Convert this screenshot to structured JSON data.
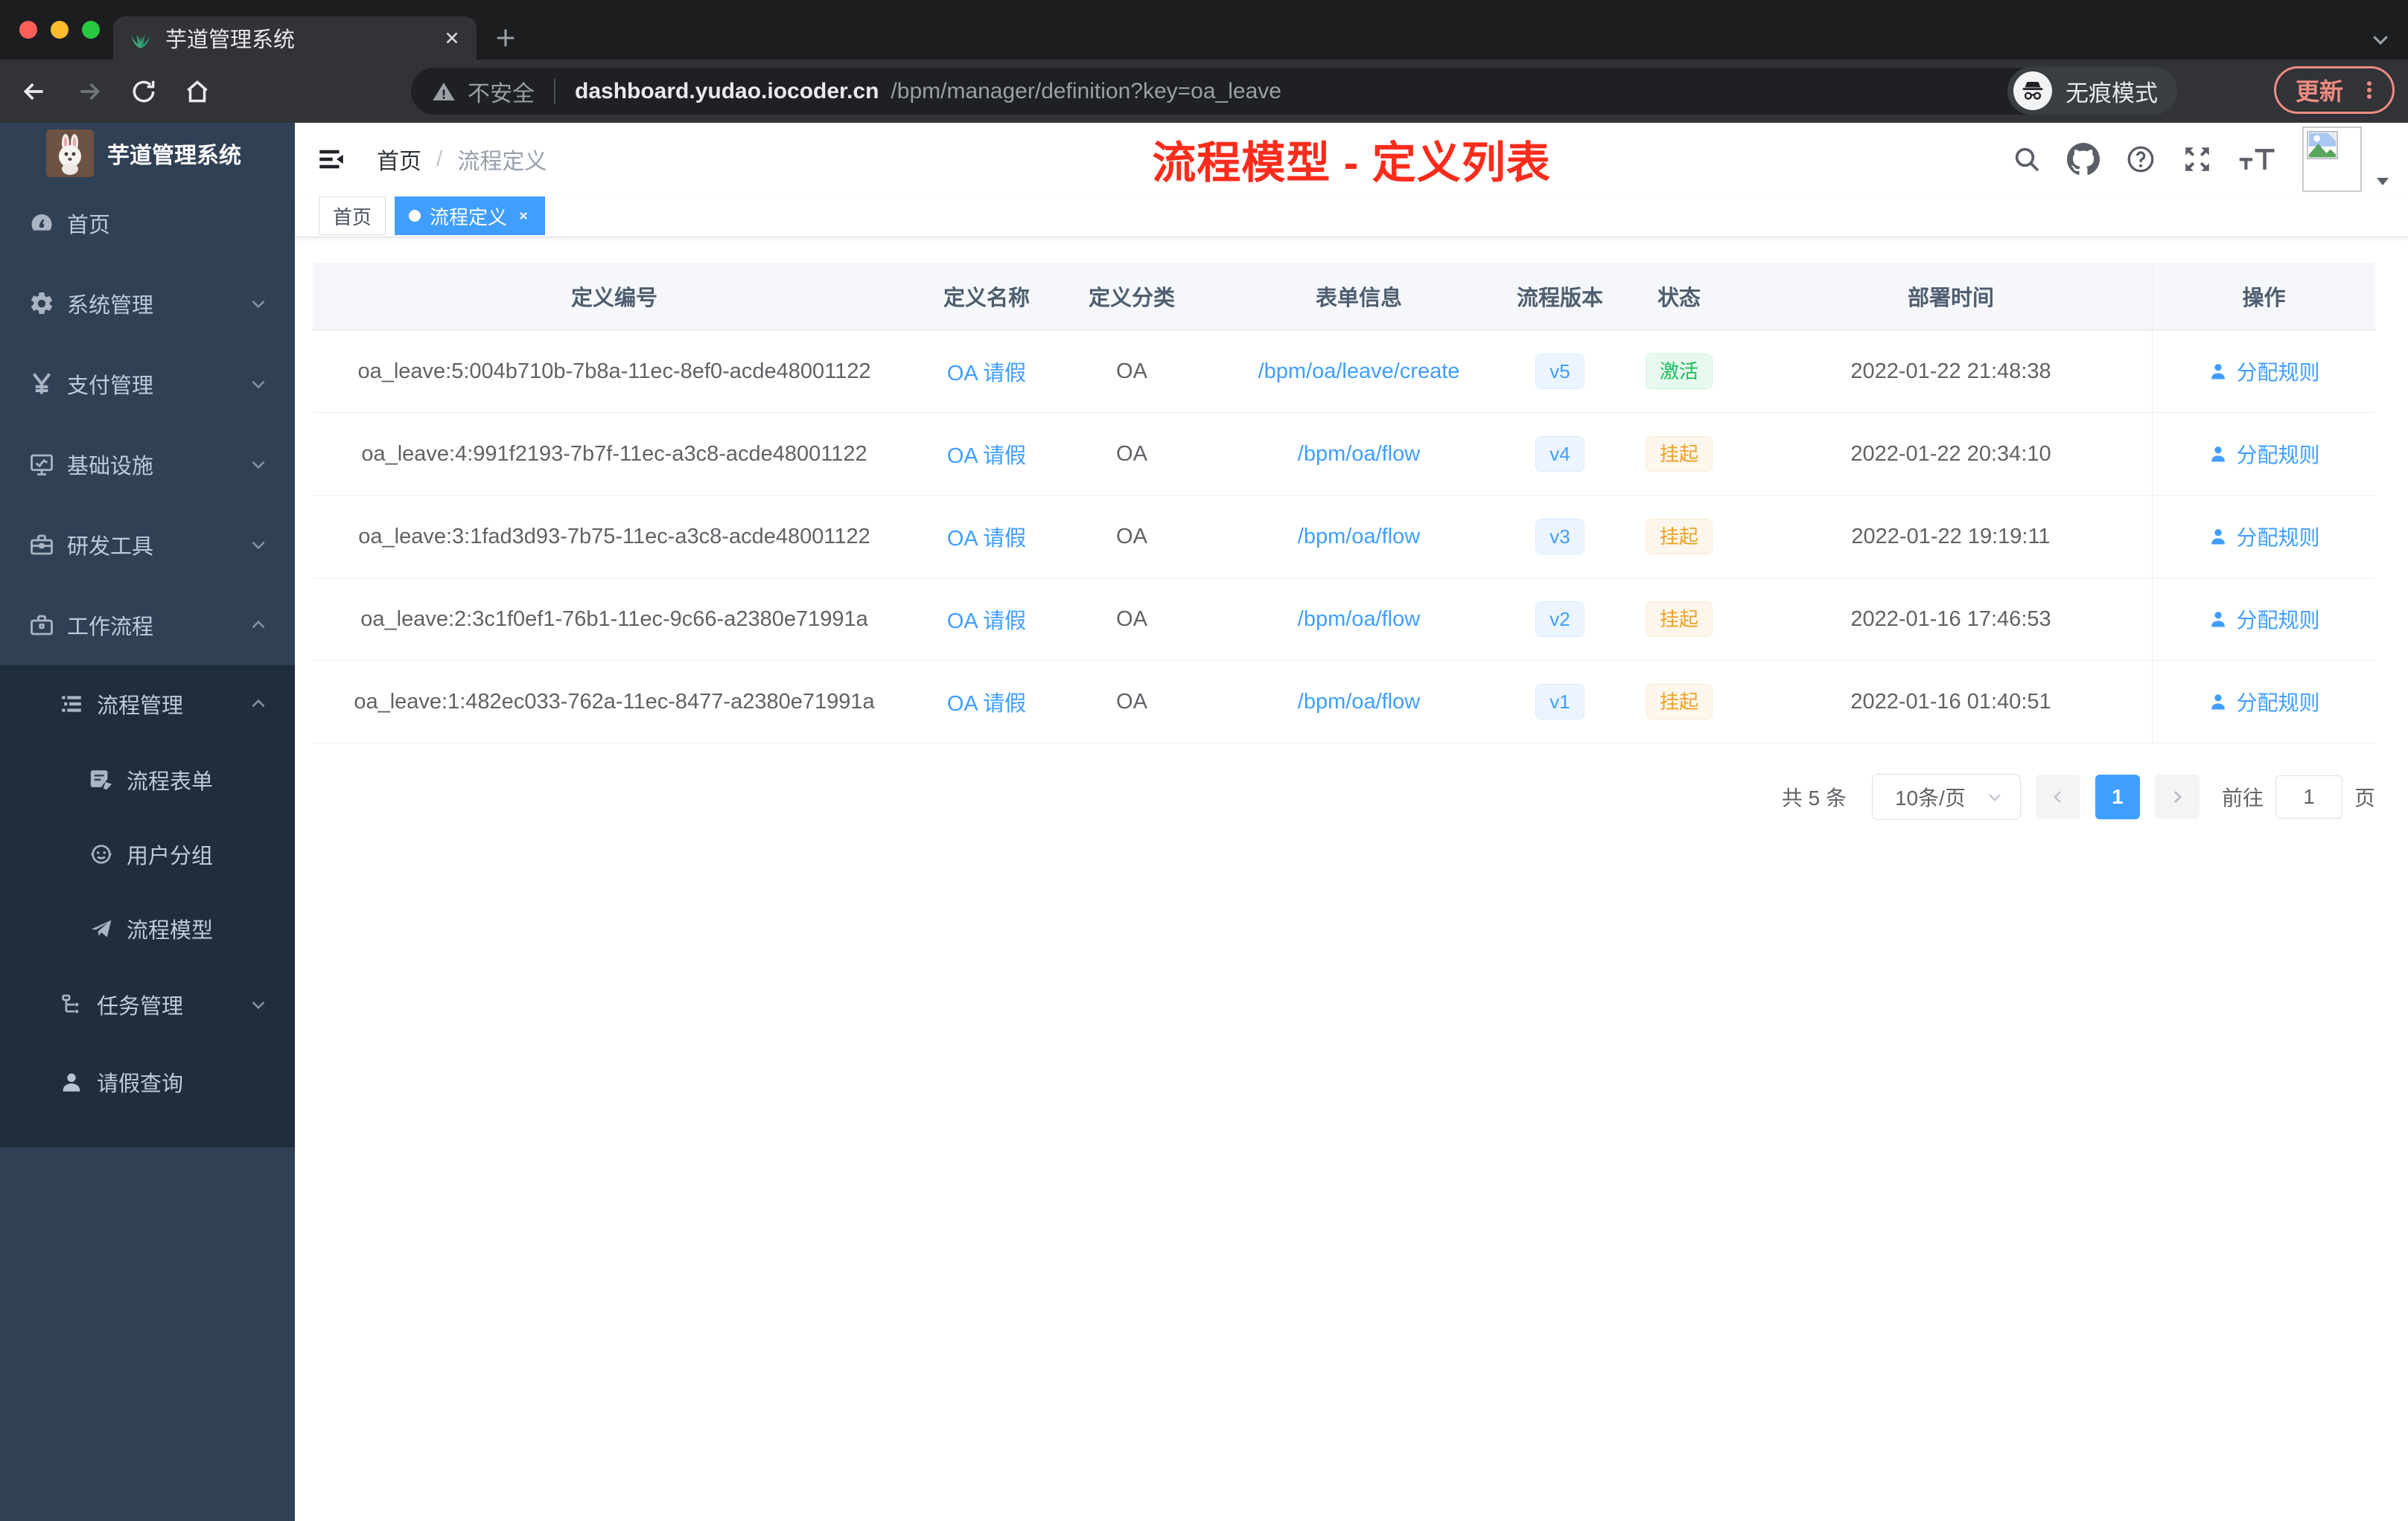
{
  "browser": {
    "tab_title": "芋道管理系统",
    "security_label": "不安全",
    "url_host": "dashboard.yudao.iocoder.cn",
    "url_path": "/bpm/manager/definition?key=oa_leave",
    "incognito_label": "无痕模式",
    "update_label": "更新"
  },
  "sidebar": {
    "app_title": "芋道管理系统",
    "items": [
      {
        "label": "首页"
      },
      {
        "label": "系统管理"
      },
      {
        "label": "支付管理"
      },
      {
        "label": "基础设施"
      },
      {
        "label": "研发工具"
      },
      {
        "label": "工作流程"
      },
      {
        "label": "流程管理"
      },
      {
        "label": "流程表单"
      },
      {
        "label": "用户分组"
      },
      {
        "label": "流程模型"
      },
      {
        "label": "任务管理"
      },
      {
        "label": "请假查询"
      }
    ]
  },
  "navbar": {
    "breadcrumb_home": "首页",
    "breadcrumb_sep": "/",
    "breadcrumb_current": "流程定义",
    "annotation": "流程模型 - 定义列表"
  },
  "tags": {
    "home": "首页",
    "active": "流程定义"
  },
  "table": {
    "columns": [
      "定义编号",
      "定义名称",
      "定义分类",
      "表单信息",
      "流程版本",
      "状态",
      "部署时间",
      "操作"
    ],
    "rows": [
      {
        "id": "oa_leave:5:004b710b-7b8a-11ec-8ef0-acde48001122",
        "name": "OA 请假",
        "category": "OA",
        "form": "/bpm/oa/leave/create",
        "version": "v5",
        "status": "激活",
        "status_type": "active",
        "time": "2022-01-22 21:48:38",
        "action": "分配规则"
      },
      {
        "id": "oa_leave:4:991f2193-7b7f-11ec-a3c8-acde48001122",
        "name": "OA 请假",
        "category": "OA",
        "form": "/bpm/oa/flow",
        "version": "v4",
        "status": "挂起",
        "status_type": "suspended",
        "time": "2022-01-22 20:34:10",
        "action": "分配规则"
      },
      {
        "id": "oa_leave:3:1fad3d93-7b75-11ec-a3c8-acde48001122",
        "name": "OA 请假",
        "category": "OA",
        "form": "/bpm/oa/flow",
        "version": "v3",
        "status": "挂起",
        "status_type": "suspended",
        "time": "2022-01-22 19:19:11",
        "action": "分配规则"
      },
      {
        "id": "oa_leave:2:3c1f0ef1-76b1-11ec-9c66-a2380e71991a",
        "name": "OA 请假",
        "category": "OA",
        "form": "/bpm/oa/flow",
        "version": "v2",
        "status": "挂起",
        "status_type": "suspended",
        "time": "2022-01-16 17:46:53",
        "action": "分配规则"
      },
      {
        "id": "oa_leave:1:482ec033-762a-11ec-8477-a2380e71991a",
        "name": "OA 请假",
        "category": "OA",
        "form": "/bpm/oa/flow",
        "version": "v1",
        "status": "挂起",
        "status_type": "suspended",
        "time": "2022-01-16 01:40:51",
        "action": "分配规则"
      }
    ]
  },
  "pagination": {
    "total": "共 5 条",
    "page_size": "10条/页",
    "current_page": "1",
    "goto_label": "前往",
    "goto_value": "1",
    "page_unit": "页"
  },
  "colors": {
    "accent": "#409eff",
    "annotation_red": "#fb2c1c",
    "sidebar_bg": "#304156",
    "submenu_bg": "#1f2d3d",
    "status_active": "#1cc05c",
    "status_suspended": "#eda224"
  }
}
